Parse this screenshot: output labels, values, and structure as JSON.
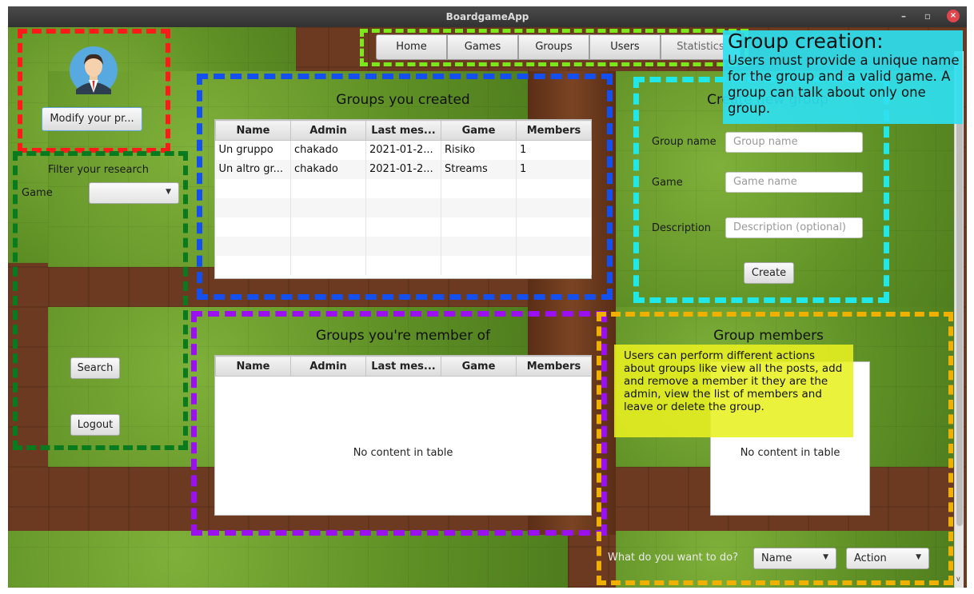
{
  "window": {
    "title": "BoardgameApp",
    "minimize": "–",
    "maximize": "▫",
    "close": "×"
  },
  "nav": {
    "home": "Home",
    "games": "Games",
    "groups": "Groups",
    "users": "Users",
    "statistics": "Statistics"
  },
  "profile": {
    "avatar": "user-avatar-icon",
    "modify_button": "Modify your pr..."
  },
  "filter": {
    "title": "Filter your research",
    "game_label": "Game",
    "game_value": "",
    "search": "Search",
    "logout": "Logout"
  },
  "created": {
    "heading": "Groups you created",
    "columns": [
      "Name",
      "Admin",
      "Last mes...",
      "Game",
      "Members"
    ],
    "rows": [
      [
        "Un gruppo",
        "chakado",
        "2021-01-2...",
        "Risiko",
        "1"
      ],
      [
        "Un altro gr...",
        "chakado",
        "2021-01-2...",
        "Streams",
        "1"
      ]
    ]
  },
  "member_of": {
    "heading": "Groups you're member of",
    "columns": [
      "Name",
      "Admin",
      "Last mes...",
      "Game",
      "Members"
    ],
    "empty": "No content in table"
  },
  "create": {
    "heading": "Create new group",
    "name_label": "Group name",
    "name_placeholder": "Group name",
    "game_label": "Game",
    "game_placeholder": "Game name",
    "desc_label": "Description",
    "desc_placeholder": "Description (optional)",
    "button": "Create"
  },
  "members": {
    "heading": "Group members",
    "empty": "No content in table",
    "action_prompt": "What do you want to do?",
    "name_select": "Name",
    "action_select": "Action"
  },
  "annotations": {
    "creation_title": "Group creation:",
    "creation_text": "Users must provide a unique name for the group and a valid game. A group can talk about only one group.",
    "actions_text": "Users can perform different actions about groups like view all the posts, add and remove a member it they are the admin, view the list of members and leave or delete the group."
  },
  "colors": {
    "red": "#ff1a1a",
    "green": "#0a7a1e",
    "blue": "#1450f0",
    "cyan": "#20e8e8",
    "lime": "#7ae81a",
    "purple": "#9a10f0",
    "amber": "#f0b000",
    "note_cyan": "#2fe0f0",
    "note_yellow": "#e8f020"
  }
}
